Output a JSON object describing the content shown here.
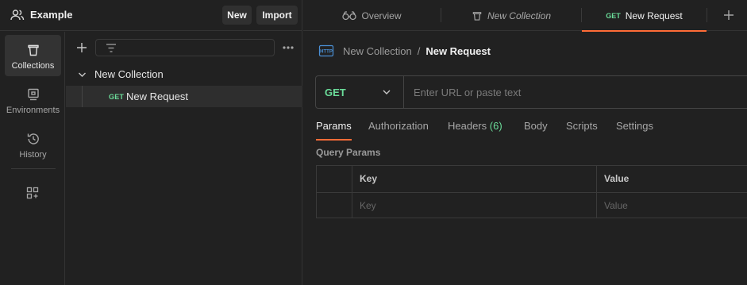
{
  "workspace": {
    "name": "Example",
    "icon": "people-icon",
    "new_label": "New",
    "import_label": "Import"
  },
  "sidebar": {
    "items": [
      {
        "label": "Collections",
        "icon": "trash-can-icon",
        "active": true
      },
      {
        "label": "Environments",
        "icon": "environment-icon",
        "active": false
      },
      {
        "label": "History",
        "icon": "history-icon",
        "active": false
      }
    ],
    "extra_icon": "apps-add-icon"
  },
  "tree": {
    "collection_name": "New Collection",
    "request": {
      "method": "GET",
      "name": "New Request"
    }
  },
  "tabs": {
    "overview_label": "Overview",
    "collection_label": "New Collection",
    "request_method": "GET",
    "request_label": "New Request"
  },
  "breadcrumb": {
    "parent": "New Collection",
    "separator": "/",
    "current": "New Request"
  },
  "request": {
    "method": "GET",
    "url_placeholder": "Enter URL or paste text",
    "url_value": ""
  },
  "request_tabs": {
    "params": "Params",
    "authorization": "Authorization",
    "headers": "Headers",
    "headers_count": "(6)",
    "body": "Body",
    "scripts": "Scripts",
    "settings": "Settings"
  },
  "query_params": {
    "title": "Query Params",
    "key_header": "Key",
    "value_header": "Value",
    "key_placeholder": "Key",
    "value_placeholder": "Value"
  },
  "colors": {
    "background": "#212121",
    "accent": "#ff6c37",
    "method_get": "#6bdd9a"
  }
}
